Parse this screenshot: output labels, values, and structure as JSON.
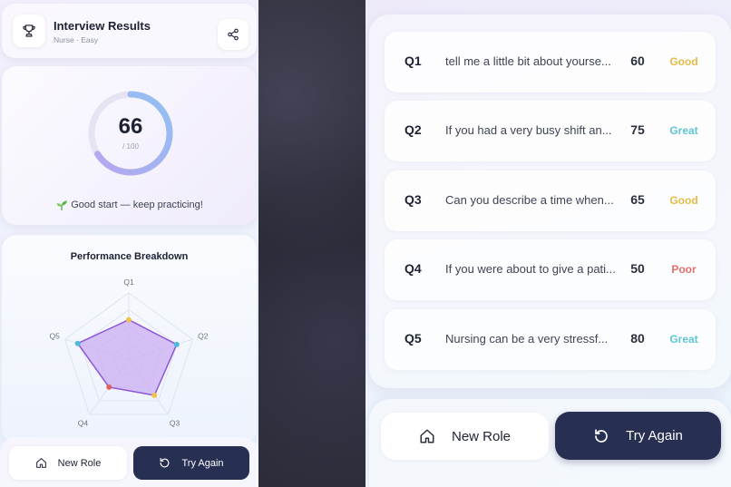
{
  "header": {
    "title": "Interview Results",
    "subtitle": "Nurse · Easy",
    "icon": "trophy-icon",
    "share_icon": "share-icon"
  },
  "score": {
    "value": "66",
    "max": "/ 100",
    "progress_fraction": 0.66,
    "feedback": "Good start — keep practicing!",
    "feedback_icon": "sprout-icon"
  },
  "performance": {
    "title": "Performance Breakdown",
    "axes": [
      "Q1",
      "Q2",
      "Q3",
      "Q4",
      "Q5"
    ],
    "scores": [
      60,
      75,
      65,
      50,
      80
    ],
    "max": 100
  },
  "questions": [
    {
      "number": "Q1",
      "text": "tell me a little bit about yourse...",
      "score": "60",
      "rating": "Good"
    },
    {
      "number": "Q2",
      "text": "If you had a very busy shift an...",
      "score": "75",
      "rating": "Great"
    },
    {
      "number": "Q3",
      "text": "Can you describe a time when...",
      "score": "65",
      "rating": "Good"
    },
    {
      "number": "Q4",
      "text": "If you were about to give a pati...",
      "score": "50",
      "rating": "Poor"
    },
    {
      "number": "Q5",
      "text": "Nursing can be a very stressf...",
      "score": "80",
      "rating": "Great"
    }
  ],
  "rating_colors": {
    "Good": "#e7bb45",
    "Great": "#5fc5d6",
    "Poor": "#e0706c"
  },
  "point_colors": [
    "#efc24a",
    "#4fb9d9",
    "#efc24a",
    "#e0605a",
    "#4fb9d9"
  ],
  "actions": {
    "new_role": "New Role",
    "try_again": "Try Again",
    "new_role_icon": "home-icon",
    "try_again_icon": "retry-icon"
  },
  "colors": {
    "accent_dark": "#272f52",
    "radar_fill": "#c9aef2",
    "radar_stroke": "#8e56d8",
    "ring_start": "#b8a5f0",
    "ring_end": "#8fc1f2"
  }
}
